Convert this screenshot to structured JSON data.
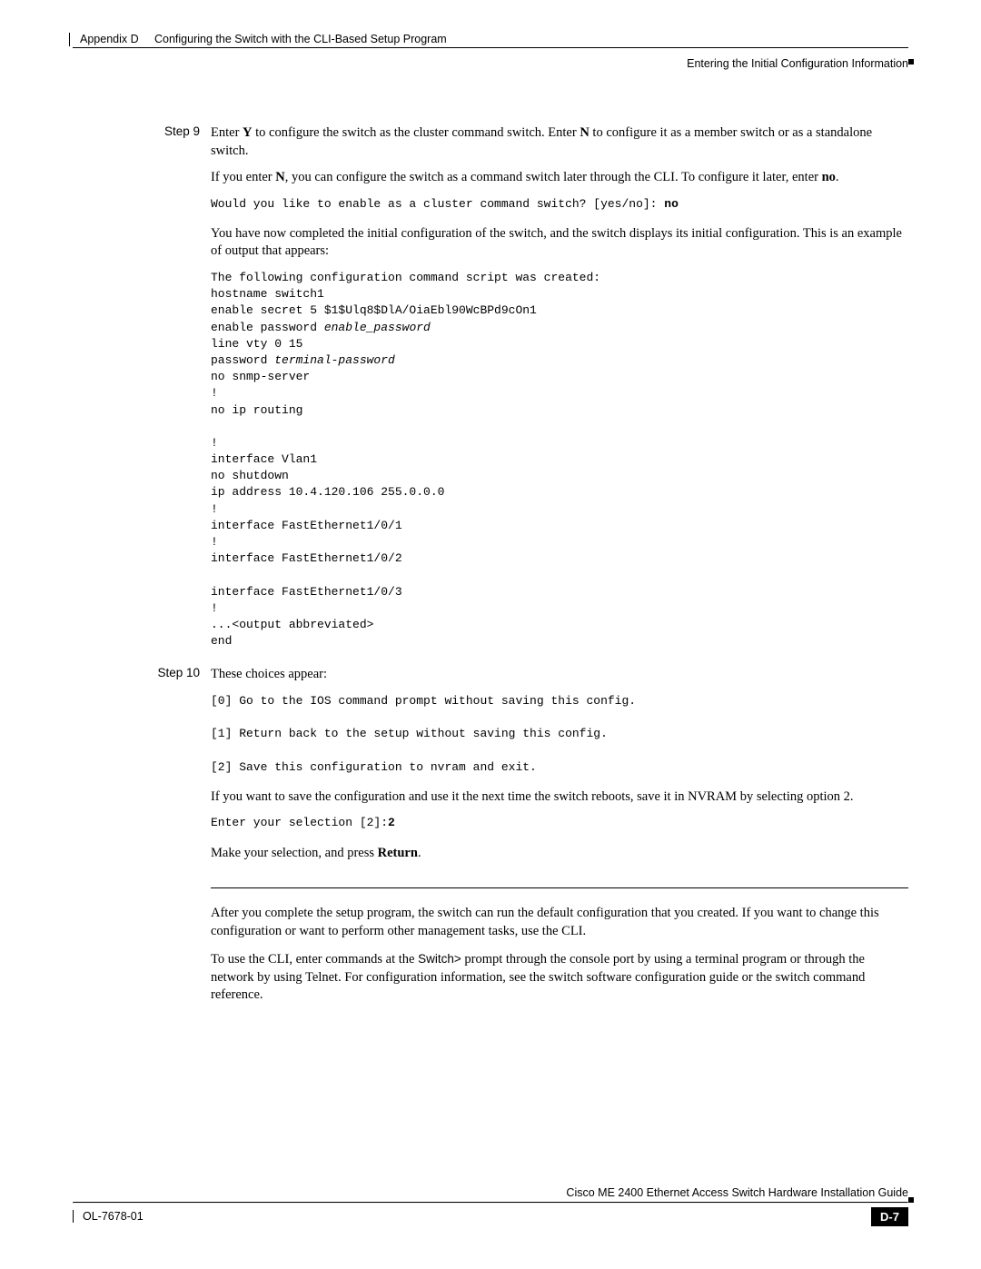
{
  "header": {
    "appendix": "Appendix D",
    "chapterTitle": "Configuring the Switch with the CLI-Based Setup Program",
    "sectionTitle": "Entering the Initial Configuration Information"
  },
  "step9": {
    "label": "Step 9",
    "para1_pre": "Enter ",
    "para1_Y": "Y",
    "para1_mid": " to configure the switch as the cluster command switch. Enter ",
    "para1_N": "N",
    "para1_post": " to configure it as a member switch or as a standalone switch.",
    "para2_pre": "If you enter ",
    "para2_N": "N",
    "para2_mid": ", you can configure the switch as a command switch later through the CLI. To configure it later, enter ",
    "para2_no": "no",
    "para2_post": ".",
    "code1_pre": "Would you like to enable as a cluster command switch? [yes/no]: ",
    "code1_ans": "no",
    "para3": "You have now completed the initial configuration of the switch, and the switch displays its initial configuration. This is an example of output that appears:",
    "code2_l1": "The following configuration command script was created:",
    "code2_l2": "hostname switch1",
    "code2_l3": "enable secret 5 $1$Ulq8$DlA/OiaEbl90WcBPd9cOn1",
    "code2_l4a": "enable password ",
    "code2_l4b": "enable_password",
    "code2_l5": "line vty 0 15",
    "code2_l6a": "password ",
    "code2_l6b": "terminal-password",
    "code2_l7": "no snmp-server",
    "code2_l8": "!",
    "code2_l9": "no ip routing",
    "code2_l10": "",
    "code2_l11": "!",
    "code2_l12": "interface Vlan1",
    "code2_l13": "no shutdown",
    "code2_l14": "ip address 10.4.120.106 255.0.0.0",
    "code2_l15": "!",
    "code2_l16": "interface FastEthernet1/0/1",
    "code2_l17": "!",
    "code2_l18": "interface FastEthernet1/0/2",
    "code2_l19": "",
    "code2_l20": "interface FastEthernet1/0/3",
    "code2_l21": "!",
    "code2_l22": "...<output abbreviated>",
    "code2_l23": "end"
  },
  "step10": {
    "label": "Step 10",
    "para1": "These choices appear:",
    "code1_l1": "[0] Go to the IOS command prompt without saving this config.",
    "code1_l2": "[1] Return back to the setup without saving this config.",
    "code1_l3": "[2] Save this configuration to nvram and exit.",
    "para2": "If you want to save the configuration and use it the next time the switch reboots, save it in NVRAM by selecting option 2.",
    "code2_pre": "Enter your selection [2]:",
    "code2_ans": "2",
    "para3_pre": "Make your selection, and press ",
    "para3_b": "Return",
    "para3_post": "."
  },
  "after": {
    "para1": "After you complete the setup program, the switch can run the default configuration that you created. If you want to change this configuration or want to perform other management tasks, use the CLI.",
    "para2_pre": "To use the CLI, enter commands at the ",
    "para2_prompt": "Switch>",
    "para2_post": " prompt through the console port by using a terminal program or through the network by using Telnet. For configuration information, see the switch software configuration guide or the switch command reference."
  },
  "footer": {
    "guideTitle": "Cisco ME 2400 Ethernet Access Switch Hardware Installation Guide",
    "ol": "OL-7678-01",
    "pageNum": "D-7"
  }
}
